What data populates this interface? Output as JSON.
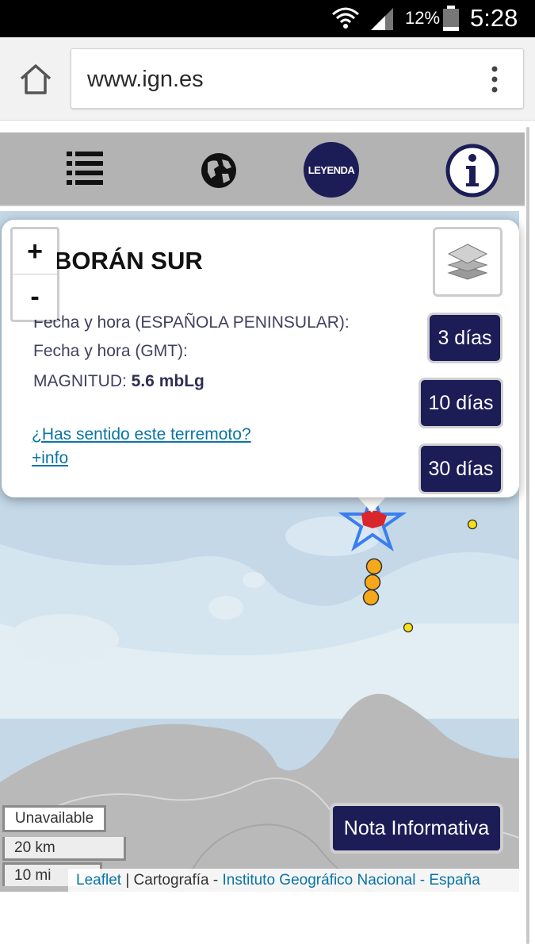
{
  "status_bar": {
    "battery": "12%",
    "time": "5:28"
  },
  "browser": {
    "url": "www.ign.es"
  },
  "toolbar": {
    "legend_label": "LEYENDA"
  },
  "popup": {
    "title": "BORÁN SUR",
    "date_local_label": "Fecha y hora (ESPAÑOLA PENINSULAR):",
    "date_gmt_label": "Fecha y hora (GMT):",
    "magnitude_label": "MAGNITUD:",
    "magnitude_value": "5.6 mbLg",
    "felt_link": "¿Has sentido este terremoto?",
    "info_link": "+info"
  },
  "map_controls": {
    "zoom_in": "+",
    "zoom_out": "-",
    "days_3": "3 días",
    "days_10": "10 días",
    "days_30": "30 días",
    "nota": "Nota Informativa",
    "unavailable": "Unavailable",
    "scale_km": "20 km",
    "scale_mi": "10 mi"
  },
  "attribution": {
    "leaflet": "Leaflet",
    "sep1": " | Cartografía - ",
    "ign": "Instituto Geográfico Nacional",
    "sep2": " - ",
    "spain": "España"
  },
  "colors": {
    "navy": "#1c1d57",
    "sea": "#c4d8e8",
    "land": "#b9b9b9",
    "quake_small": "#f7e018",
    "quake_medium": "#f6a81a",
    "star_outline": "#3a7ef0"
  }
}
